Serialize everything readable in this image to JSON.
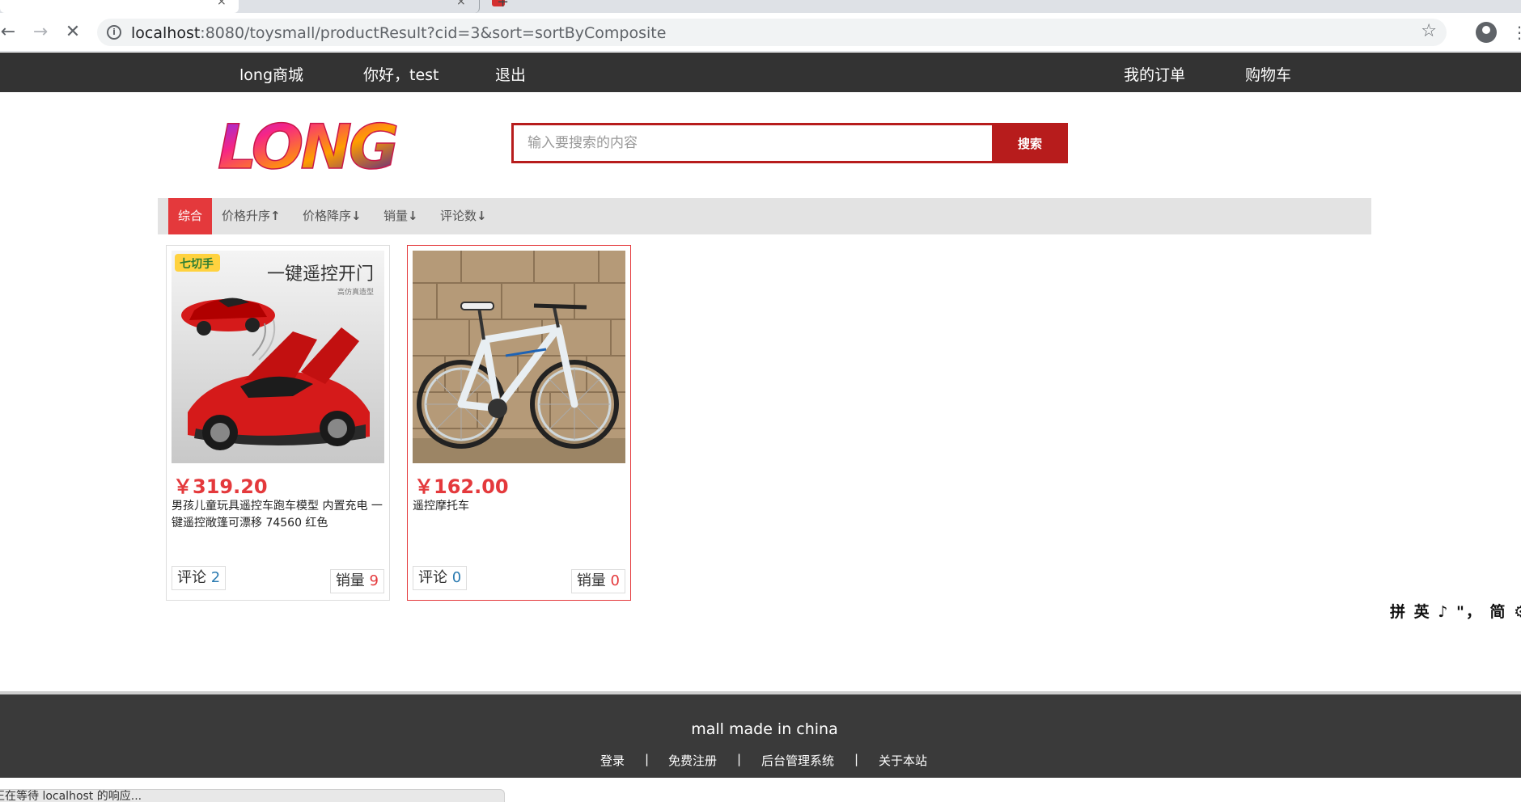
{
  "browser": {
    "url_host": "localhost",
    "url_rest": ":8080/toysmall/productResult?cid=3&sort=sortByComposite",
    "status_text": "正在等待 localhost 的响应..."
  },
  "topnav": {
    "brand": "long商城",
    "greeting": "你好，test",
    "logout": "退出",
    "orders": "我的订单",
    "cart": "购物车"
  },
  "header": {
    "logo_text": "LONG",
    "search_placeholder": "输入要搜索的内容",
    "search_button": "搜索"
  },
  "sort": {
    "items": [
      {
        "label": "综合",
        "active": true
      },
      {
        "label": "价格升序",
        "arrow": "↑"
      },
      {
        "label": "价格降序",
        "arrow": "↓"
      },
      {
        "label": "销量",
        "arrow": "↓"
      },
      {
        "label": "评论数",
        "arrow": "↓"
      }
    ]
  },
  "products": [
    {
      "price": "￥319.20",
      "title": "男孩儿童玩具遥控车跑车模型 内置充电 一键遥控敞篷可漂移 74560 红色",
      "image_tag": "一键遥控开门",
      "image_subtag": "高仿真造型",
      "image_brand": "七切手",
      "comment_label": "评论",
      "comment_count": "2",
      "sales_label": "销量",
      "sales_count": "9"
    },
    {
      "price": "￥162.00",
      "title": "遥控摩托车",
      "comment_label": "评论",
      "comment_count": "0",
      "sales_label": "销量",
      "sales_count": "0"
    }
  ],
  "ime": {
    "text": "拼 英 ♪ \"， 简 ⚙"
  },
  "footer": {
    "title": "mall made in china",
    "links": [
      "登录",
      "免费注册",
      "后台管理系统",
      "关于本站"
    ],
    "separator": "|"
  },
  "colors": {
    "accent": "#e4393c",
    "search_red": "#b71c1c",
    "nav_bg": "#333333",
    "footer_bg": "#3a3a3a"
  }
}
